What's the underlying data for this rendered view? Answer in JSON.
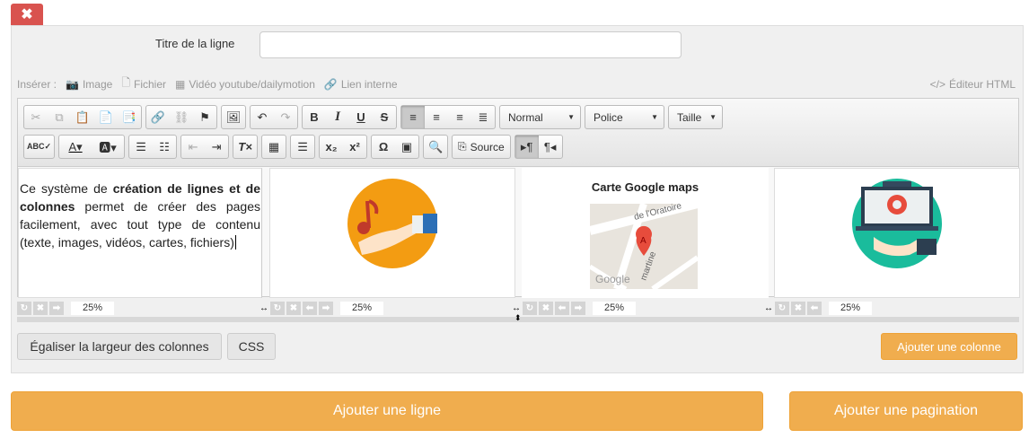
{
  "close_button": {
    "glyph": "✖"
  },
  "title_row": {
    "label": "Titre de la ligne",
    "value": "",
    "placeholder": ""
  },
  "insert_bar": {
    "prefix": "Insérer :",
    "items": [
      {
        "label": "Image",
        "icon": "camera-icon"
      },
      {
        "label": "Fichier",
        "icon": "file-icon"
      },
      {
        "label": "Vidéo youtube/dailymotion",
        "icon": "film-icon"
      },
      {
        "label": "Lien interne",
        "icon": "link-icon"
      }
    ],
    "html_editor": "Éditeur HTML"
  },
  "toolbar": {
    "format_combo": "Normal",
    "font_combo": "Police",
    "size_combo": "Taille",
    "source_label": "Source"
  },
  "columns": [
    {
      "text_parts": [
        "Ce système de ",
        "création de lignes et de colonnes",
        " permet de créer des pages facilement, avec tout type de contenu (texte, images, vidéos, cartes, fichiers)"
      ],
      "width": "25%"
    },
    {
      "image": "music-hand-illustration",
      "width": "25%"
    },
    {
      "title": "Carte Google maps",
      "map_street_1": "de l'Oratoire",
      "map_street_2": "martine",
      "map_brand": "Google",
      "width": "25%"
    },
    {
      "image": "computer-settings-illustration",
      "width": "25%"
    }
  ],
  "actions": {
    "equalize": "Égaliser la largeur des colonnes",
    "css": "CSS",
    "add_column": "Ajouter une colonne",
    "add_row": "Ajouter une ligne",
    "add_pagination": "Ajouter une pagination"
  },
  "colors": {
    "orange": "#f0ad4e",
    "red": "#d9534f",
    "teal": "#1abc9c",
    "yellow_orange": "#f39c12"
  }
}
